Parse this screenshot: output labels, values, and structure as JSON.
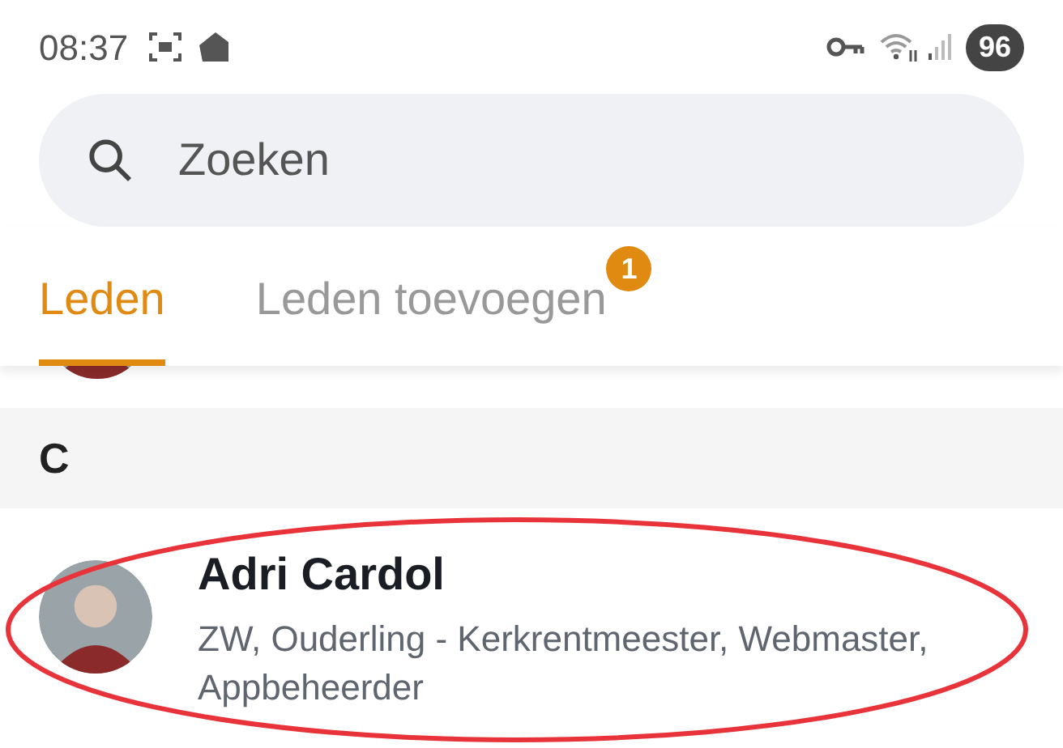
{
  "status_bar": {
    "time": "08:37",
    "battery": "96"
  },
  "search": {
    "placeholder": "Zoeken"
  },
  "tabs": [
    {
      "label": "Leden",
      "selected": true
    },
    {
      "label": "Leden toevoegen",
      "selected": false,
      "badge": "1"
    }
  ],
  "sections": [
    {
      "letter": "C",
      "members": [
        {
          "name": "Adri Cardol",
          "roles": "ZW, Ouderling - Kerkrentmeester, Webmaster, Appbeheerder"
        }
      ]
    }
  ]
}
